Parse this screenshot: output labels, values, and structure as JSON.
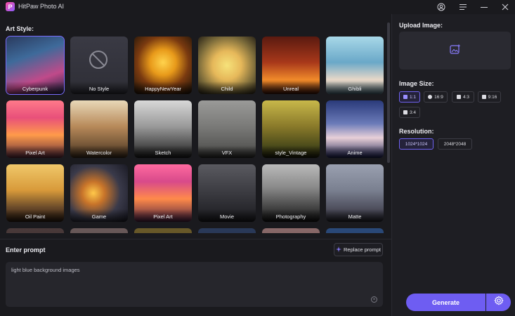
{
  "app": {
    "title": "HitPaw Photo AI",
    "logo_letter": "P"
  },
  "left": {
    "art_style_label": "Art Style:",
    "styles": [
      {
        "label": "Cyberpunk",
        "bg": "linear-gradient(160deg,#2a3a5e 0%,#3e6a9a 35%,#c04a8a 70%,#1c2444 100%)",
        "selected": true
      },
      {
        "label": "No Style",
        "bg": "linear-gradient(180deg,#3a3a44,#2e2e36)"
      },
      {
        "label": "HappyNewYear",
        "bg": "radial-gradient(circle at 50% 45%,#ffd34d 0%,#e89a1a 30%,#7a3a10 60%,#1a1208 100%)"
      },
      {
        "label": "Child",
        "bg": "radial-gradient(circle at 50% 50%,#f6e27a 0%,#e6b85a 35%,#7a6a3a 70%,#2a2418 100%)"
      },
      {
        "label": "Unreal",
        "bg": "linear-gradient(180deg,#5a1a10 0%,#a8381a 45%,#f08a2a 75%,#3a1208 100%)"
      },
      {
        "label": "Ghibli",
        "bg": "linear-gradient(180deg,#a8d8e8 0%,#6aa8c8 45%,#e8d8c8 75%,#4a6a78 100%)"
      },
      {
        "label": "Pixel Art",
        "bg": "linear-gradient(180deg,#ff7a8a 0%,#e8507a 30%,#ff9a4a 60%,#5a2a3a 100%)"
      },
      {
        "label": "Watercolor",
        "bg": "linear-gradient(180deg,#e8d8b8 0%,#b88a5a 45%,#7a5a3a 75%,#3a2a1a 100%)"
      },
      {
        "label": "Sketch",
        "bg": "linear-gradient(180deg,#d8d8d8 0%,#9a9a9a 45%,#4a4a4a 80%,#1a1a1a 100%)"
      },
      {
        "label": "VFX",
        "bg": "linear-gradient(180deg,#9a9a98 0%,#7a7a78 45%,#5a5a58 80%,#2a2a28 100%)"
      },
      {
        "label": "style_Vintage",
        "bg": "linear-gradient(180deg,#c8b84a 0%,#8a7a2a 45%,#4a4a1a 80%,#1a1a0a 100%)"
      },
      {
        "label": "Anime",
        "bg": "linear-gradient(180deg,#2a3a7a 0%,#6a7ab8 40%,#e8d0d8 65%,#1a2050 100%)"
      },
      {
        "label": "Oil Paint",
        "bg": "linear-gradient(180deg,#f0c86a 0%,#d89a3a 45%,#6a4a2a 75%,#2a1a10 100%)"
      },
      {
        "label": "Game",
        "bg": "radial-gradient(circle at 40% 50%,#ffc84a 0%,#c8742a 25%,#3a3a4a 60%,#1a1a24 100%)"
      },
      {
        "label": "Pixel Art",
        "bg": "linear-gradient(180deg,#ff6aa0 0%,#d84a8a 30%,#ff8a4a 60%,#4a2040 100%)"
      },
      {
        "label": "Movie",
        "bg": "linear-gradient(180deg,#5a5a60 0%,#3a3a40 50%,#1a1a1e 100%)"
      },
      {
        "label": "Photography",
        "bg": "linear-gradient(180deg,#bababa 0%,#8a8a8a 40%,#3a3a3a 80%,#121212 100%)"
      },
      {
        "label": "Matte",
        "bg": "linear-gradient(180deg,#9aa0b0 0%,#7a8090 45%,#4a4a58 80%,#22222a 100%)"
      },
      {
        "label": "",
        "bg": "linear-gradient(180deg,#4a3a3a,#2a2020)"
      },
      {
        "label": "",
        "bg": "linear-gradient(180deg,#6a5a5a,#3a3030)"
      },
      {
        "label": "",
        "bg": "linear-gradient(180deg,#6a5a2a,#3a3010)"
      },
      {
        "label": "",
        "bg": "linear-gradient(180deg,#2a3a5a,#1a2030)"
      },
      {
        "label": "",
        "bg": "linear-gradient(180deg,#8a6a6a,#4a3a3a)"
      },
      {
        "label": "",
        "bg": "linear-gradient(180deg,#2a4a7a,#1a2440)"
      }
    ],
    "prompt_label": "Enter prompt",
    "replace_prompt_label": "Replace prompt",
    "prompt_text": "light blue background images"
  },
  "right": {
    "upload_label": "Upload Image:",
    "size_label": "Image Size:",
    "sizes": [
      {
        "label": "1:1",
        "active": true
      },
      {
        "label": "16:9"
      },
      {
        "label": "4:3"
      },
      {
        "label": "9:16"
      },
      {
        "label": "3:4"
      }
    ],
    "resolution_label": "Resolution:",
    "resolutions": [
      {
        "label": "1024*1024",
        "active": true
      },
      {
        "label": "2048*2048"
      }
    ],
    "generate_label": "Generate"
  },
  "colors": {
    "accent": "#6e5df2",
    "selected_outline": "#7b6dff"
  }
}
